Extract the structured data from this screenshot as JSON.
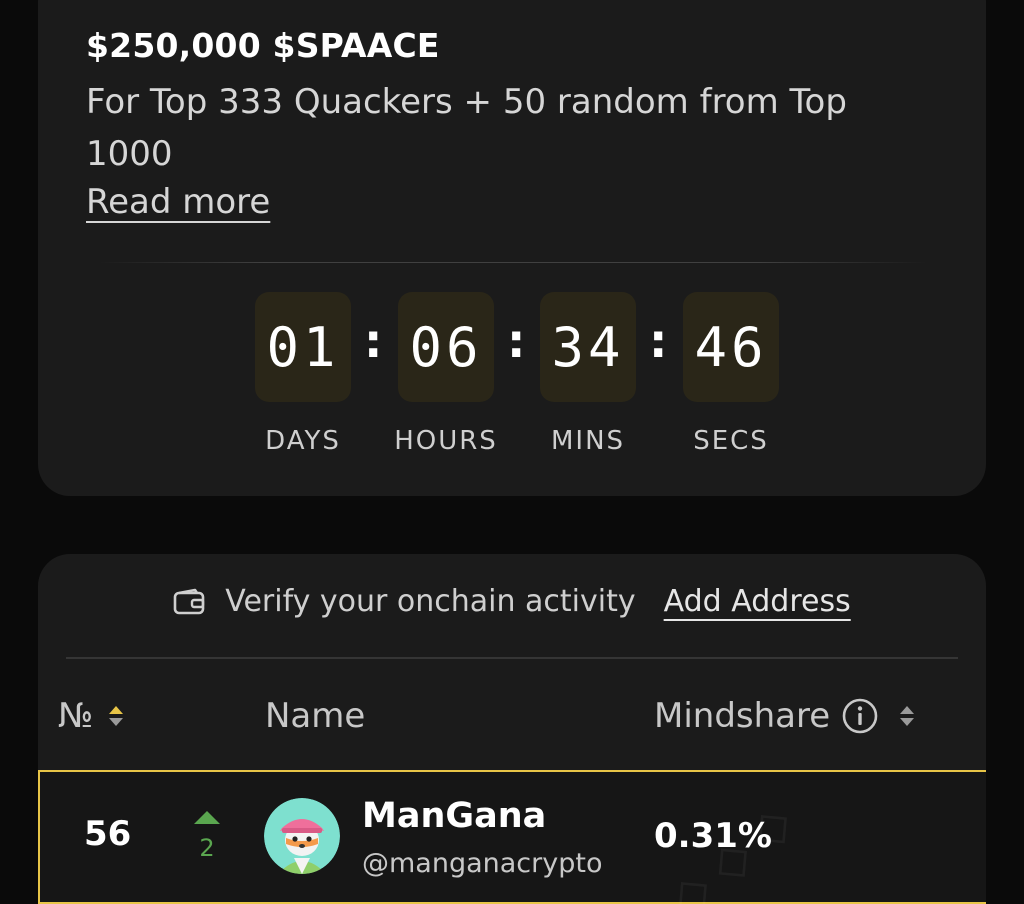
{
  "reward": {
    "title": "$250,000 $SPAACE",
    "description": "For Top 333 Quackers + 50 random from Top 1000",
    "read_more": "Read more"
  },
  "countdown": {
    "days": "01",
    "hours": "06",
    "mins": "34",
    "secs": "46",
    "separator": ":",
    "labels": {
      "days": "DAYS",
      "hours": "HOURS",
      "mins": "MINS",
      "secs": "SECS"
    }
  },
  "verify": {
    "text": "Verify your onchain activity",
    "link": "Add Address",
    "icon": "wallet-icon"
  },
  "table": {
    "headers": {
      "rank": "№",
      "name": "Name",
      "mindshare": "Mindshare"
    },
    "rows": [
      {
        "rank": "56",
        "change": "2",
        "change_direction": "up",
        "name": "ManGana",
        "handle": "@manganacrypto",
        "mindshare": "0.31%",
        "highlighted": true
      }
    ]
  },
  "colors": {
    "accent": "#e8c547",
    "up": "#5aa64f",
    "card": "#1b1b1b",
    "timer_box": "#2a2618"
  }
}
